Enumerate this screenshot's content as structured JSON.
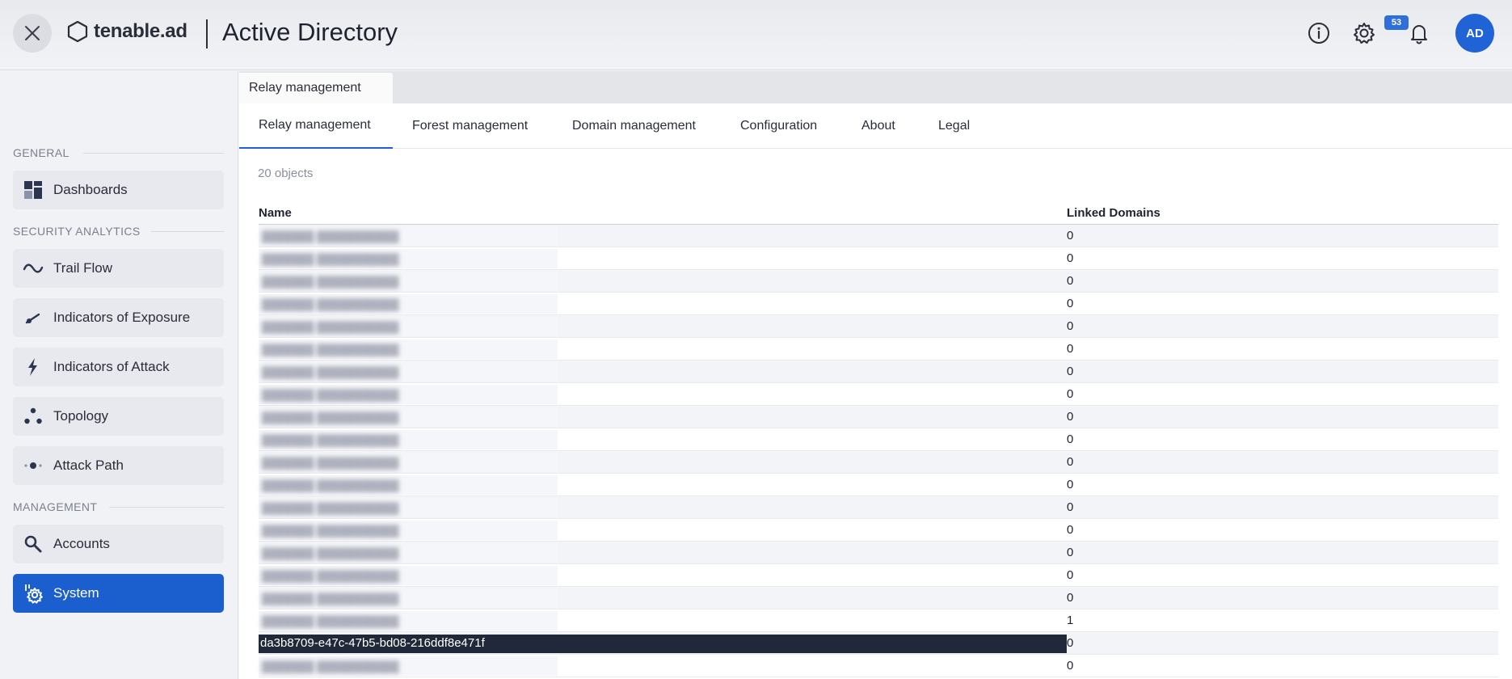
{
  "header": {
    "close_icon": "close-icon",
    "logo_text": "tenable.ad",
    "title": "Active Directory",
    "notification_count": "53",
    "avatar_initials": "AD"
  },
  "sidebar": {
    "sections": [
      {
        "label": "GENERAL"
      },
      {
        "label": "SECURITY ANALYTICS"
      },
      {
        "label": "MANAGEMENT"
      }
    ],
    "items": [
      {
        "label": "Dashboards",
        "icon": "dashboard-icon"
      },
      {
        "label": "Trail Flow",
        "icon": "wave-icon"
      },
      {
        "label": "Indicators of Exposure",
        "icon": "gauge-icon"
      },
      {
        "label": "Indicators of Attack",
        "icon": "bolt-icon"
      },
      {
        "label": "Topology",
        "icon": "topology-icon"
      },
      {
        "label": "Attack Path",
        "icon": "attack-path-icon"
      },
      {
        "label": "Accounts",
        "icon": "key-search-icon"
      },
      {
        "label": "System",
        "icon": "system-gear-icon",
        "active": true
      }
    ]
  },
  "main": {
    "top_tab": "Relay management",
    "tabs": [
      {
        "label": "Relay management",
        "active": true
      },
      {
        "label": "Forest management"
      },
      {
        "label": "Domain management"
      },
      {
        "label": "Configuration"
      },
      {
        "label": "About"
      },
      {
        "label": "Legal"
      }
    ],
    "object_count": "20 objects",
    "table": {
      "columns": [
        "Name",
        "Linked Domains"
      ],
      "rows": [
        {
          "linked": "0"
        },
        {
          "linked": "0"
        },
        {
          "linked": "0"
        },
        {
          "linked": "0"
        },
        {
          "linked": "0"
        },
        {
          "linked": "0"
        },
        {
          "linked": "0"
        },
        {
          "linked": "0"
        },
        {
          "linked": "0"
        },
        {
          "linked": "0"
        },
        {
          "linked": "0"
        },
        {
          "linked": "0"
        },
        {
          "linked": "0"
        },
        {
          "linked": "0"
        },
        {
          "linked": "0"
        },
        {
          "linked": "0"
        },
        {
          "linked": "0"
        },
        {
          "linked": "1"
        },
        {
          "name": "da3b8709-e47c-47b5-bd08-216ddf8e471f",
          "linked": "0",
          "selected": true
        },
        {
          "linked": "0"
        }
      ]
    }
  },
  "colors": {
    "accent": "#1a5fcd",
    "badge": "#2f6fda",
    "selected_row": "#20283a"
  }
}
